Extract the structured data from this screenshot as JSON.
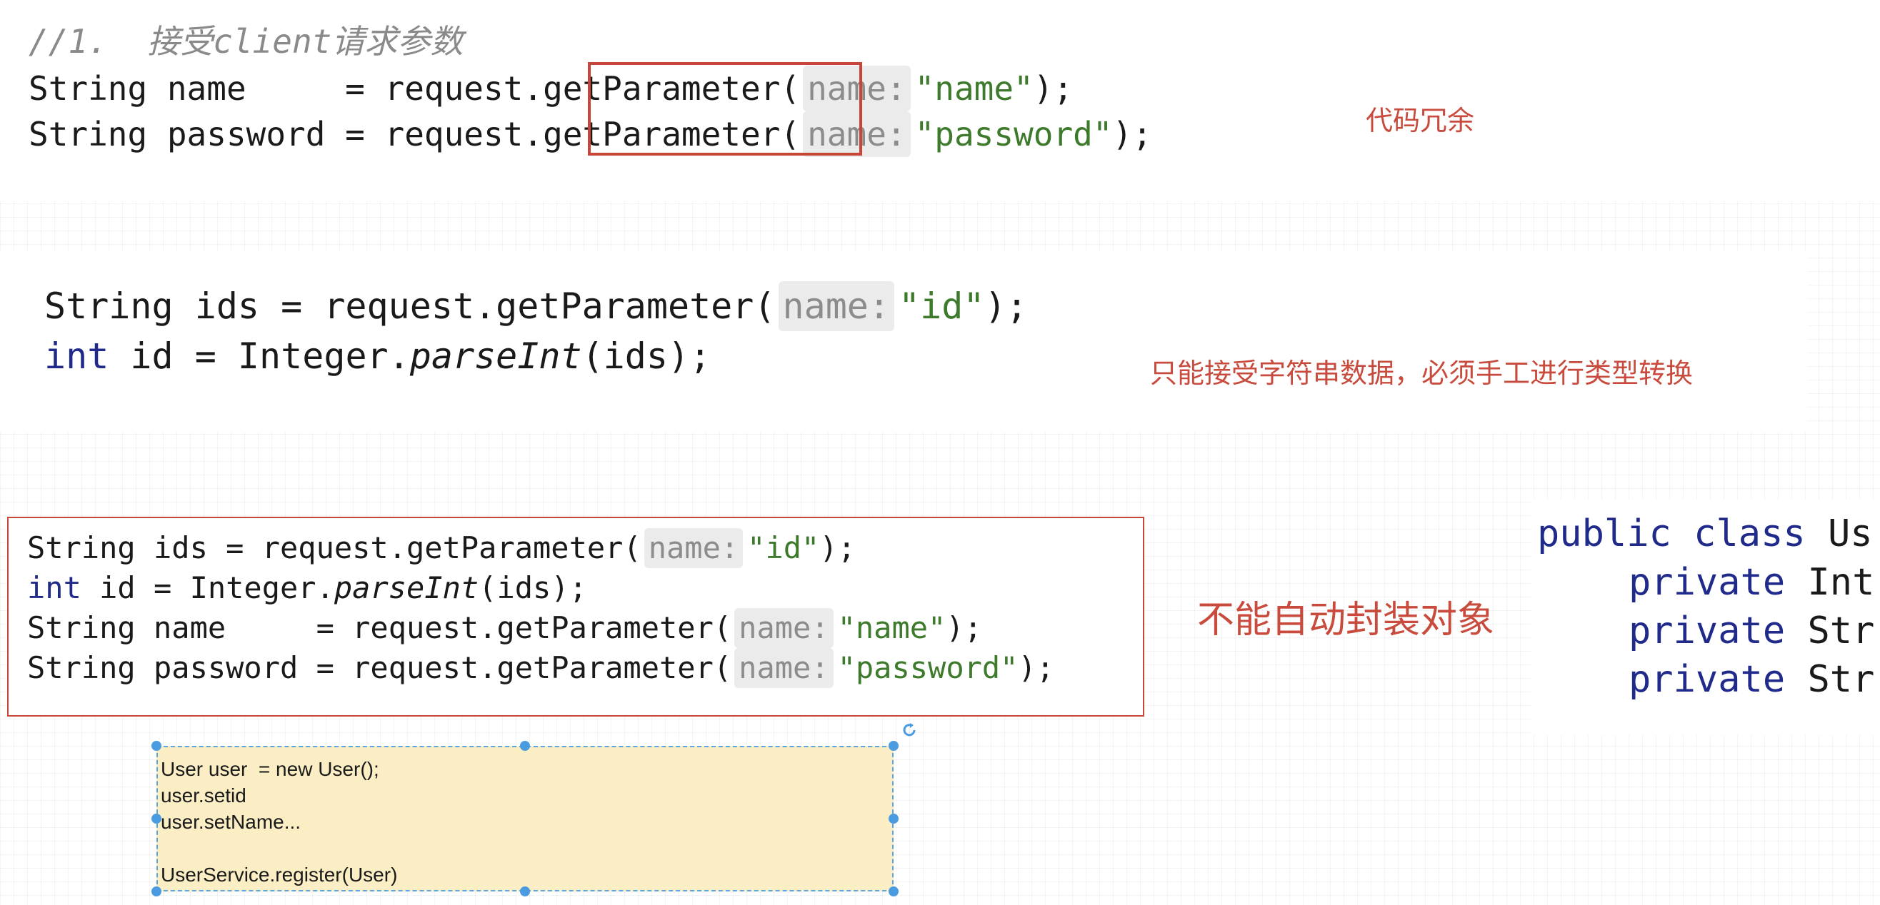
{
  "section1": {
    "comment": "//1.  接受client请求参数",
    "line1": {
      "prefix": "String name     = request.",
      "method": "getParameter",
      "open": "(",
      "hint": "name:",
      "str": "\"name\"",
      "close": ");"
    },
    "line2": {
      "prefix": "String password = request.",
      "method": "getParameter",
      "open": "(",
      "hint": "name:",
      "str": "\"password\"",
      "close": ");"
    },
    "note": "代码冗余"
  },
  "section2": {
    "line1": {
      "prefix": "String ids = request.getParameter(",
      "hint": "name:",
      "str": "\"id\"",
      "close": ");"
    },
    "line2": {
      "kw": "int",
      "mid": " id = Integer.",
      "method": "parseInt",
      "close": "(ids);"
    },
    "note": "只能接受字符串数据，必须手工进行类型转换"
  },
  "section3": {
    "line1": {
      "prefix": "String ids = request.getParameter(",
      "hint": "name:",
      "str": "\"id\"",
      "close": ");"
    },
    "line2": {
      "kw": "int",
      "mid": " id = Integer.",
      "method": "parseInt",
      "close": "(ids);"
    },
    "line3": {
      "prefix": "String name     = request.getParameter(",
      "hint": "name:",
      "str": "\"name\"",
      "close": ");"
    },
    "line4": {
      "prefix": "String password = request.getParameter(",
      "hint": "name:",
      "str": "\"password\"",
      "close": ");"
    },
    "note": "不能自动封装对象"
  },
  "class_snippet": {
    "line1": {
      "kw": "public class",
      "rest": " Us"
    },
    "line2": {
      "kw": "private",
      "rest": " Int"
    },
    "line3": {
      "kw": "private",
      "rest": " Str"
    },
    "line4": {
      "kw": "private",
      "rest": " Str"
    }
  },
  "sticky_note": {
    "line1": "User user  = new User();",
    "line2": "user.setid",
    "line3": "user.setName...",
    "line4": "",
    "line5": "UserService.register(User)"
  },
  "colors": {
    "accent_red": "#c84b3d",
    "keyword": "#1f2a8a",
    "string": "#3d7a2c",
    "sticky_bg": "#fbeec4",
    "selection": "#4a9be0"
  }
}
